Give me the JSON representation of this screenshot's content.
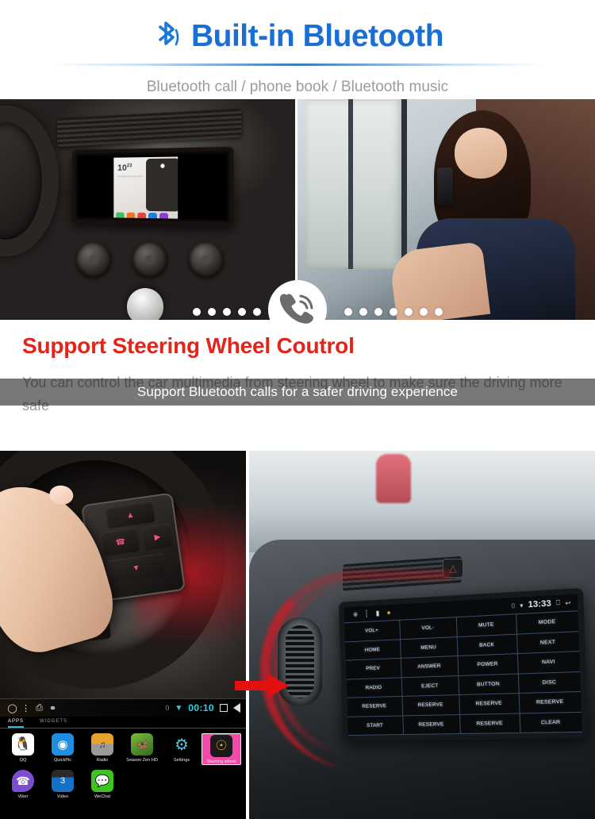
{
  "header": {
    "icon": "bluetooth-icon",
    "title": "Built-in Bluetooth",
    "subtitle": "Bluetooth call / phone book / Bluetooth music",
    "title_color": "#1a6fd4",
    "subtitle_color": "#9b9b9b"
  },
  "top_section": {
    "caption": "Support Bluetooth calls for a safer driving experience",
    "call_icon": "phone-call-icon",
    "left_photo_alt": "car-dashboard-head-unit",
    "right_photo_alt": "woman-talking-on-phone",
    "head_unit_clock": "10",
    "head_unit_clock_sup": "23",
    "head_unit_sub": "Tuesday, December 2nd"
  },
  "mid_section": {
    "title": "Support Steering Wheel Coutrol",
    "body": "You can control the car multimedia from steering wheel to make sure the driving more safe",
    "title_color": "#e2251b",
    "body_color": "#999999"
  },
  "launcher": {
    "status_bar": {
      "home_icon": "circle-home-icon",
      "menu_icon": "overflow-menu-icon",
      "screenshot_icon": "screenshot-icon",
      "usb_icon": "usb-icon",
      "battery": "0",
      "wifi_icon": "wifi-icon",
      "clock": "00:10",
      "recents_icon": "square-recents-icon",
      "back_icon": "triangle-back-icon"
    },
    "tabs": [
      {
        "label": "APPS",
        "active": true
      },
      {
        "label": "WIDGETS",
        "active": false
      }
    ],
    "apps_row1": [
      {
        "name": "QQ",
        "icon": "qq-penguin-icon",
        "selected": false
      },
      {
        "name": "QuickPic",
        "icon": "quickpic-icon",
        "selected": false
      },
      {
        "name": "Radio",
        "icon": "radio-icon",
        "selected": false
      },
      {
        "name": "Season Zen HD",
        "icon": "butterfly-icon",
        "selected": false
      },
      {
        "name": "Settings",
        "icon": "gear-icon",
        "selected": false
      },
      {
        "name": "Steering wheel",
        "icon": "steering-wheel-icon",
        "selected": true
      }
    ],
    "apps_row2": [
      {
        "name": "Viber",
        "icon": "viber-icon",
        "selected": false
      },
      {
        "name": "Video",
        "icon": "video-icon",
        "selected": false
      },
      {
        "name": "WeChat",
        "icon": "wechat-icon",
        "selected": false
      }
    ],
    "arrow_icon": "red-right-arrow-icon",
    "arrow_color": "#e2100f"
  },
  "head_unit": {
    "status_bar": {
      "home_icon": "home-outline-icon",
      "sim_icon": "sim-icon",
      "battery_icon": "battery-icon",
      "dot_icon": "orange-dot-icon",
      "battery": "0",
      "wifi_icon": "wifi-icon",
      "clock": "13:33",
      "recents_icon": "recents-icon",
      "back_icon": "back-arrow-icon"
    },
    "grid_title": "steering-wheel-key-study-grid",
    "grid": [
      [
        "VOL+",
        "VOL-",
        "MUTE",
        "MODE"
      ],
      [
        "HOME",
        "MENU",
        "BACK",
        "NEXT"
      ],
      [
        "PREV",
        "ANSWER",
        "POWER",
        "NAVI"
      ],
      [
        "RADIO",
        "EJECT",
        "BUTTON",
        "DISC"
      ],
      [
        "RESERVE",
        "RESERVE",
        "RESERVE",
        "RESERVE"
      ],
      [
        "START",
        "RESERVE",
        "RESERVE",
        "CLEAR"
      ]
    ]
  },
  "steering_photo": {
    "alt": "finger-pressing-steering-wheel-buttons",
    "button_icons": [
      "volume-up-icon",
      "phone-icon",
      "triangle-icon",
      "volume-down-icon",
      "source-icon"
    ],
    "backlight_color": "#ff4d7a"
  }
}
